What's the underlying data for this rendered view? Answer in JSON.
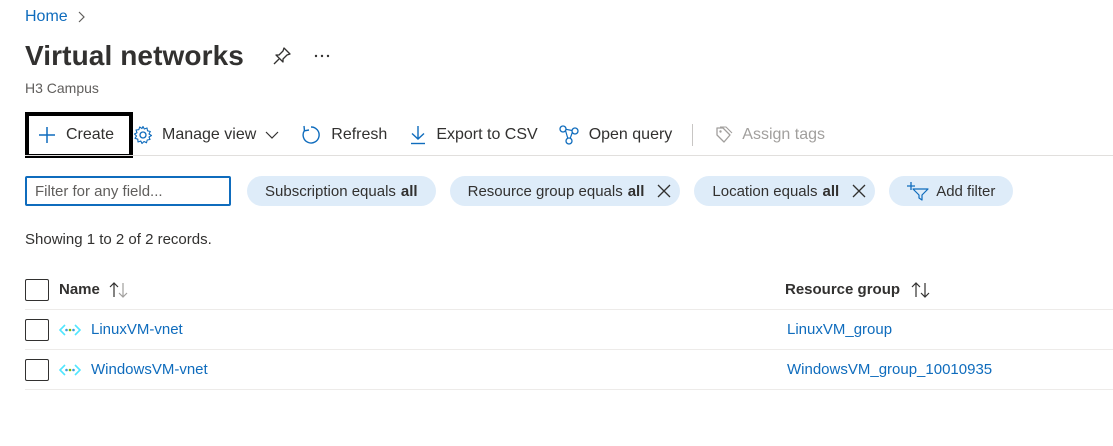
{
  "breadcrumb": {
    "home": "Home"
  },
  "page": {
    "title": "Virtual networks",
    "subtitle": "H3 Campus"
  },
  "toolbar": {
    "create": "Create",
    "manage_view": "Manage view",
    "refresh": "Refresh",
    "export": "Export to CSV",
    "open_query": "Open query",
    "assign_tags": "Assign tags"
  },
  "filters": {
    "placeholder": "Filter for any field...",
    "pills": [
      {
        "label": "Subscription equals",
        "value": "all"
      },
      {
        "label": "Resource group equals",
        "value": "all"
      },
      {
        "label": "Location equals",
        "value": "all"
      }
    ],
    "add_filter": "Add filter"
  },
  "records_text": "Showing 1 to 2 of 2 records.",
  "table": {
    "columns": {
      "name": "Name",
      "resource_group": "Resource group"
    },
    "rows": [
      {
        "name": "LinuxVM-vnet",
        "resource_group": "LinuxVM_group"
      },
      {
        "name": "WindowsVM-vnet",
        "resource_group": "WindowsVM_group_10010935"
      }
    ]
  },
  "colors": {
    "accent": "#0f6cbd",
    "pill_bg": "#deecf9",
    "vnet_icon": "#50e6ff"
  },
  "icons": [
    "chevron-right-icon",
    "pin-icon",
    "more-icon",
    "plus-icon",
    "gear-icon",
    "chevron-down-icon",
    "refresh-icon",
    "download-icon",
    "query-icon",
    "tag-icon",
    "close-icon",
    "add-filter-icon",
    "sort-icon",
    "vnet-icon"
  ]
}
